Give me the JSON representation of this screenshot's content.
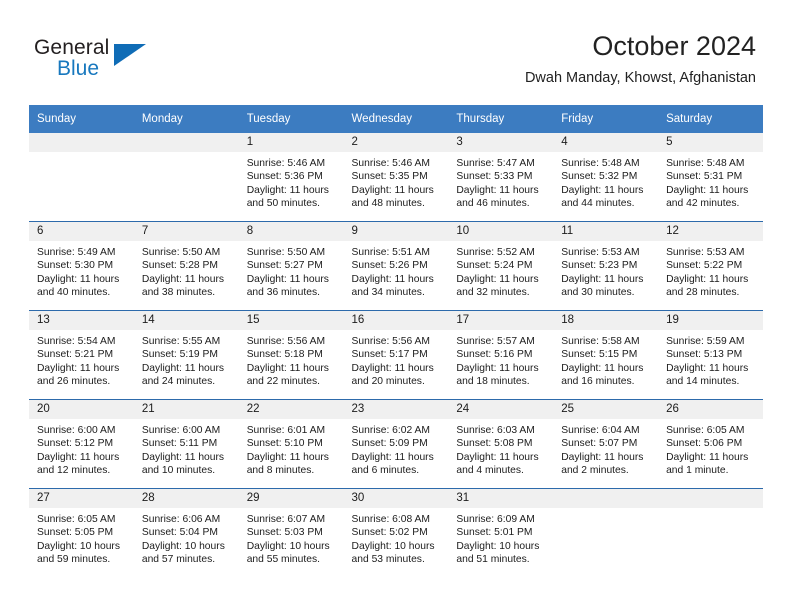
{
  "brand": {
    "name_part1": "General",
    "name_part2": "Blue",
    "accent_color": "#0f6cb6"
  },
  "header": {
    "title": "October 2024",
    "subtitle": "Dwah Manday, Khowst, Afghanistan"
  },
  "colors": {
    "header_row": "#3c7cc1",
    "week_divider": "#2d6aab",
    "daynum_strip": "#f0f0f0"
  },
  "weekdays": [
    "Sunday",
    "Monday",
    "Tuesday",
    "Wednesday",
    "Thursday",
    "Friday",
    "Saturday"
  ],
  "weeks": [
    [
      {
        "day": "",
        "blank": true
      },
      {
        "day": "",
        "blank": true
      },
      {
        "day": "1",
        "sunrise": "Sunrise: 5:46 AM",
        "sunset": "Sunset: 5:36 PM",
        "daylight1": "Daylight: 11 hours",
        "daylight2": "and 50 minutes."
      },
      {
        "day": "2",
        "sunrise": "Sunrise: 5:46 AM",
        "sunset": "Sunset: 5:35 PM",
        "daylight1": "Daylight: 11 hours",
        "daylight2": "and 48 minutes."
      },
      {
        "day": "3",
        "sunrise": "Sunrise: 5:47 AM",
        "sunset": "Sunset: 5:33 PM",
        "daylight1": "Daylight: 11 hours",
        "daylight2": "and 46 minutes."
      },
      {
        "day": "4",
        "sunrise": "Sunrise: 5:48 AM",
        "sunset": "Sunset: 5:32 PM",
        "daylight1": "Daylight: 11 hours",
        "daylight2": "and 44 minutes."
      },
      {
        "day": "5",
        "sunrise": "Sunrise: 5:48 AM",
        "sunset": "Sunset: 5:31 PM",
        "daylight1": "Daylight: 11 hours",
        "daylight2": "and 42 minutes."
      }
    ],
    [
      {
        "day": "6",
        "sunrise": "Sunrise: 5:49 AM",
        "sunset": "Sunset: 5:30 PM",
        "daylight1": "Daylight: 11 hours",
        "daylight2": "and 40 minutes."
      },
      {
        "day": "7",
        "sunrise": "Sunrise: 5:50 AM",
        "sunset": "Sunset: 5:28 PM",
        "daylight1": "Daylight: 11 hours",
        "daylight2": "and 38 minutes."
      },
      {
        "day": "8",
        "sunrise": "Sunrise: 5:50 AM",
        "sunset": "Sunset: 5:27 PM",
        "daylight1": "Daylight: 11 hours",
        "daylight2": "and 36 minutes."
      },
      {
        "day": "9",
        "sunrise": "Sunrise: 5:51 AM",
        "sunset": "Sunset: 5:26 PM",
        "daylight1": "Daylight: 11 hours",
        "daylight2": "and 34 minutes."
      },
      {
        "day": "10",
        "sunrise": "Sunrise: 5:52 AM",
        "sunset": "Sunset: 5:24 PM",
        "daylight1": "Daylight: 11 hours",
        "daylight2": "and 32 minutes."
      },
      {
        "day": "11",
        "sunrise": "Sunrise: 5:53 AM",
        "sunset": "Sunset: 5:23 PM",
        "daylight1": "Daylight: 11 hours",
        "daylight2": "and 30 minutes."
      },
      {
        "day": "12",
        "sunrise": "Sunrise: 5:53 AM",
        "sunset": "Sunset: 5:22 PM",
        "daylight1": "Daylight: 11 hours",
        "daylight2": "and 28 minutes."
      }
    ],
    [
      {
        "day": "13",
        "sunrise": "Sunrise: 5:54 AM",
        "sunset": "Sunset: 5:21 PM",
        "daylight1": "Daylight: 11 hours",
        "daylight2": "and 26 minutes."
      },
      {
        "day": "14",
        "sunrise": "Sunrise: 5:55 AM",
        "sunset": "Sunset: 5:19 PM",
        "daylight1": "Daylight: 11 hours",
        "daylight2": "and 24 minutes."
      },
      {
        "day": "15",
        "sunrise": "Sunrise: 5:56 AM",
        "sunset": "Sunset: 5:18 PM",
        "daylight1": "Daylight: 11 hours",
        "daylight2": "and 22 minutes."
      },
      {
        "day": "16",
        "sunrise": "Sunrise: 5:56 AM",
        "sunset": "Sunset: 5:17 PM",
        "daylight1": "Daylight: 11 hours",
        "daylight2": "and 20 minutes."
      },
      {
        "day": "17",
        "sunrise": "Sunrise: 5:57 AM",
        "sunset": "Sunset: 5:16 PM",
        "daylight1": "Daylight: 11 hours",
        "daylight2": "and 18 minutes."
      },
      {
        "day": "18",
        "sunrise": "Sunrise: 5:58 AM",
        "sunset": "Sunset: 5:15 PM",
        "daylight1": "Daylight: 11 hours",
        "daylight2": "and 16 minutes."
      },
      {
        "day": "19",
        "sunrise": "Sunrise: 5:59 AM",
        "sunset": "Sunset: 5:13 PM",
        "daylight1": "Daylight: 11 hours",
        "daylight2": "and 14 minutes."
      }
    ],
    [
      {
        "day": "20",
        "sunrise": "Sunrise: 6:00 AM",
        "sunset": "Sunset: 5:12 PM",
        "daylight1": "Daylight: 11 hours",
        "daylight2": "and 12 minutes."
      },
      {
        "day": "21",
        "sunrise": "Sunrise: 6:00 AM",
        "sunset": "Sunset: 5:11 PM",
        "daylight1": "Daylight: 11 hours",
        "daylight2": "and 10 minutes."
      },
      {
        "day": "22",
        "sunrise": "Sunrise: 6:01 AM",
        "sunset": "Sunset: 5:10 PM",
        "daylight1": "Daylight: 11 hours",
        "daylight2": "and 8 minutes."
      },
      {
        "day": "23",
        "sunrise": "Sunrise: 6:02 AM",
        "sunset": "Sunset: 5:09 PM",
        "daylight1": "Daylight: 11 hours",
        "daylight2": "and 6 minutes."
      },
      {
        "day": "24",
        "sunrise": "Sunrise: 6:03 AM",
        "sunset": "Sunset: 5:08 PM",
        "daylight1": "Daylight: 11 hours",
        "daylight2": "and 4 minutes."
      },
      {
        "day": "25",
        "sunrise": "Sunrise: 6:04 AM",
        "sunset": "Sunset: 5:07 PM",
        "daylight1": "Daylight: 11 hours",
        "daylight2": "and 2 minutes."
      },
      {
        "day": "26",
        "sunrise": "Sunrise: 6:05 AM",
        "sunset": "Sunset: 5:06 PM",
        "daylight1": "Daylight: 11 hours",
        "daylight2": "and 1 minute."
      }
    ],
    [
      {
        "day": "27",
        "sunrise": "Sunrise: 6:05 AM",
        "sunset": "Sunset: 5:05 PM",
        "daylight1": "Daylight: 10 hours",
        "daylight2": "and 59 minutes."
      },
      {
        "day": "28",
        "sunrise": "Sunrise: 6:06 AM",
        "sunset": "Sunset: 5:04 PM",
        "daylight1": "Daylight: 10 hours",
        "daylight2": "and 57 minutes."
      },
      {
        "day": "29",
        "sunrise": "Sunrise: 6:07 AM",
        "sunset": "Sunset: 5:03 PM",
        "daylight1": "Daylight: 10 hours",
        "daylight2": "and 55 minutes."
      },
      {
        "day": "30",
        "sunrise": "Sunrise: 6:08 AM",
        "sunset": "Sunset: 5:02 PM",
        "daylight1": "Daylight: 10 hours",
        "daylight2": "and 53 minutes."
      },
      {
        "day": "31",
        "sunrise": "Sunrise: 6:09 AM",
        "sunset": "Sunset: 5:01 PM",
        "daylight1": "Daylight: 10 hours",
        "daylight2": "and 51 minutes."
      },
      {
        "day": "",
        "blank": true
      },
      {
        "day": "",
        "blank": true
      }
    ]
  ]
}
